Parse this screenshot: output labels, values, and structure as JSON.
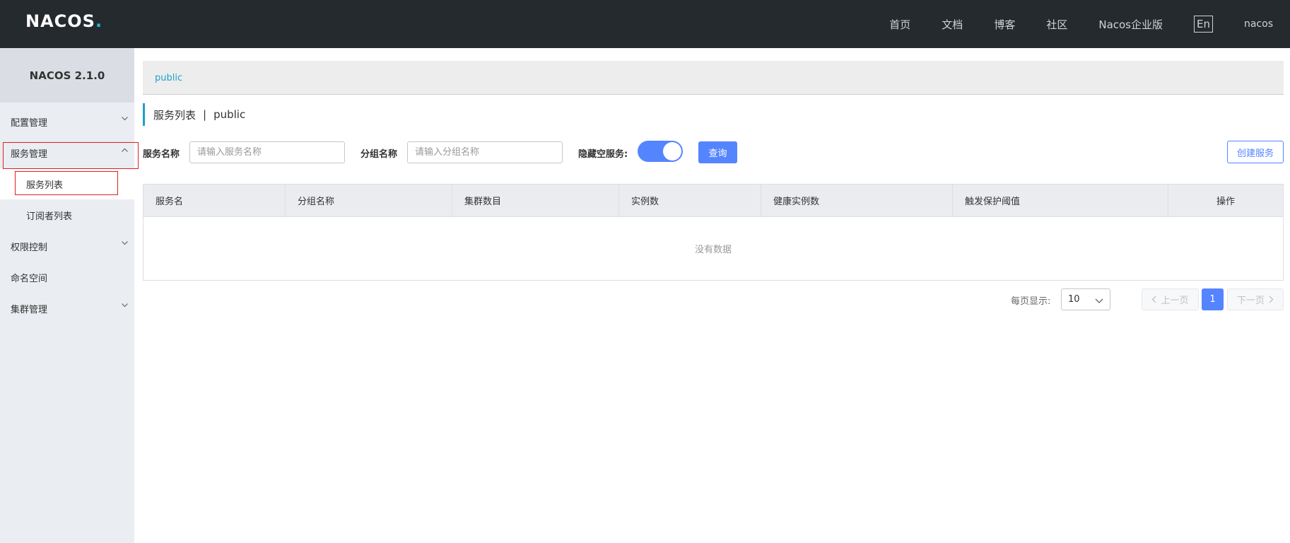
{
  "header": {
    "logo": "NACOS",
    "nav": [
      "首页",
      "文档",
      "博客",
      "社区",
      "Nacos企业版"
    ],
    "lang": "En",
    "user": "nacos"
  },
  "sidebar": {
    "version": "NACOS 2.1.0",
    "items": [
      {
        "label": "配置管理",
        "expanded": false
      },
      {
        "label": "服务管理",
        "expanded": true
      },
      {
        "label": "服务列表",
        "active": true
      },
      {
        "label": "订阅者列表"
      },
      {
        "label": "权限控制",
        "expanded": false
      },
      {
        "label": "命名空间"
      },
      {
        "label": "集群管理",
        "expanded": false
      }
    ]
  },
  "main": {
    "breadcrumb": "public",
    "title": "服务列表",
    "title_sep": "|",
    "namespace": "public",
    "filters": {
      "service_name_label": "服务名称",
      "service_name_placeholder": "请输入服务名称",
      "group_name_label": "分组名称",
      "group_name_placeholder": "请输入分组名称",
      "hide_empty_label": "隐藏空服务:",
      "hide_empty_on": true,
      "query_label": "查询",
      "create_label": "创建服务"
    },
    "table": {
      "columns": [
        "服务名",
        "分组名称",
        "集群数目",
        "实例数",
        "健康实例数",
        "触发保护阈值",
        "操作"
      ],
      "empty_text": "没有数据"
    },
    "pagination": {
      "page_size_label": "每页显示:",
      "page_size": "10",
      "prev_label": "上一页",
      "current_page": "1",
      "next_label": "下一页"
    }
  },
  "colors": {
    "topbar": "#252a2f",
    "primary": "#5584ff",
    "accent": "#1c9fd0",
    "highlight_box": "#e02020"
  }
}
